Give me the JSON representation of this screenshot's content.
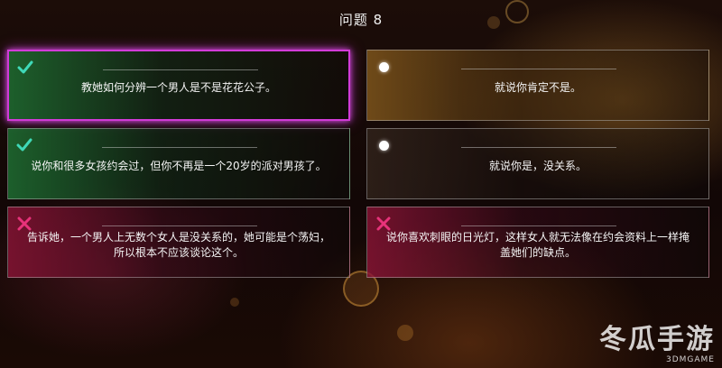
{
  "title": "问题 8",
  "answers": [
    {
      "text": "教她如何分辨一个男人是不是花花公子。",
      "icon": "check-icon",
      "state": "selected"
    },
    {
      "text": "就说你肯定不是。",
      "icon": "dot-icon",
      "state": "neutral"
    },
    {
      "text": "说你和很多女孩约会过，但你不再是一个20岁的派对男孩了。",
      "icon": "check-icon",
      "state": "correct"
    },
    {
      "text": "就说你是，没关系。",
      "icon": "dot-icon",
      "state": "neutral"
    },
    {
      "text": "告诉她，一个男人上无数个女人是没关系的，她可能是个荡妇，所以根本不应该谈论这个。",
      "icon": "cross-icon",
      "state": "wrong"
    },
    {
      "text": "说你喜欢刺眼的日光灯，这样女人就无法像在约会资料上一样掩盖她们的缺点。",
      "icon": "cross-icon",
      "state": "wrong"
    }
  ],
  "colors": {
    "check": "#3fd9b8",
    "cross": "#e8327a",
    "selected_border": "#d23bd8"
  },
  "watermark": {
    "logo": "冬瓜手游",
    "site": "3DMGAME"
  }
}
